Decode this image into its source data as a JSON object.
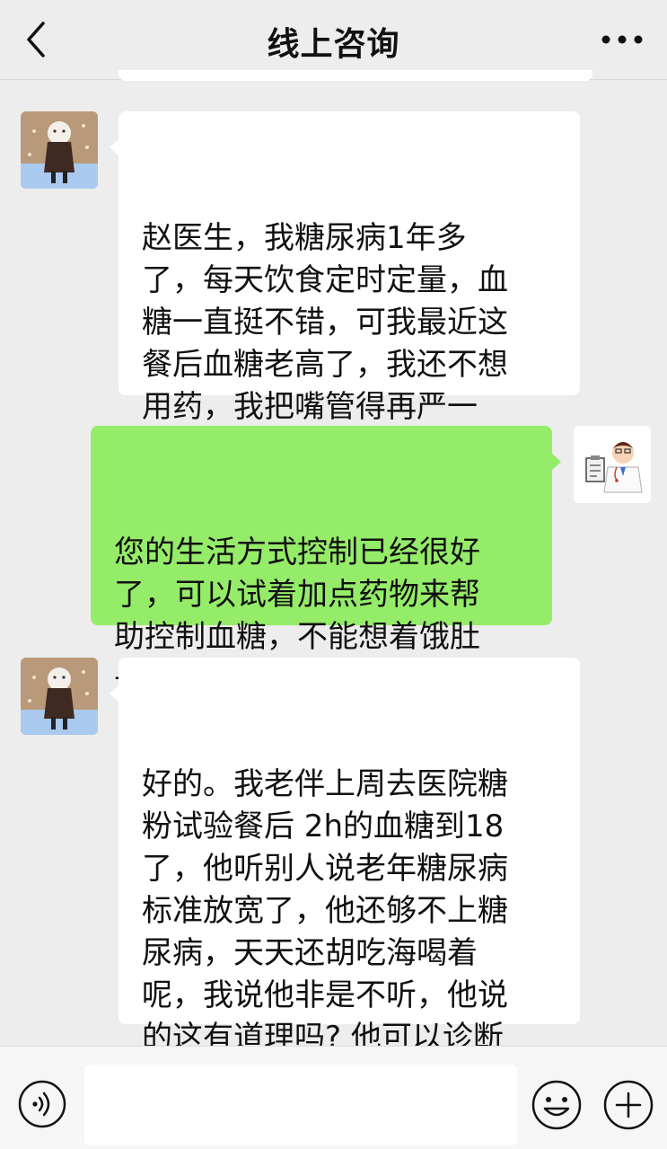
{
  "header": {
    "title": "线上咨询",
    "back_icon": "chevron-left-icon",
    "more_icon": "more-dots-icon"
  },
  "messages": [
    {
      "sender": "patient",
      "text": "赵医生，我糖尿病1年多\n了，每天饮食定时定量，血\n糖一直挺不错，可我最近这\n餐后血糖老高了，我还不想\n用药，我把嘴管得再严一\n点，这可行吗?"
    },
    {
      "sender": "doctor",
      "text": "您的生活方式控制已经很好\n了，可以试着加点药物来帮\n助控制血糖，不能想着饿肚\n子来降血糖哦",
      "emoji": "smile-emoji-icon"
    },
    {
      "sender": "patient",
      "text": "好的。我老伴上周去医院糖\n粉试验餐后 2h的血糖到18\n了，他听别人说老年糖尿病\n标准放宽了，他还够不上糖\n尿病，天天还胡吃海喝着\n呢，我说他非是不听，他说\n的这有道理吗? 他可以诊断\n糖尿病吗?"
    }
  ],
  "input_bar": {
    "placeholder": "",
    "voice_icon": "voice-icon",
    "emoji_icon": "emoji-icon",
    "plus_icon": "plus-icon"
  },
  "colors": {
    "background": "#ededed",
    "incoming_bubble": "#ffffff",
    "outgoing_bubble": "#95ec69",
    "text": "#111111"
  }
}
